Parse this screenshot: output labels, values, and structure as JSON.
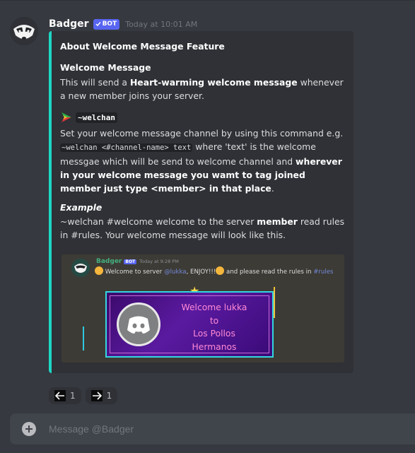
{
  "message": {
    "username": "Badger",
    "bot_tag": "BOT",
    "timestamp": "Today at 10:01 AM"
  },
  "embed": {
    "accent_color": "#1ed6c4",
    "title": "About Welcome Message Feature",
    "field1": {
      "name": "Welcome Message",
      "text_a": "This will send a ",
      "text_bold": "Heart-warming welcome message",
      "text_b": " whenever a new member joins your server."
    },
    "field2": {
      "command": "~welchan",
      "text_a": "Set your welcome message channel by using this command e.g. ",
      "code": "~welchan <#channel-name> text",
      "text_b": " where 'text' is the welcome messgae which will be send to welcome channel and ",
      "text_bold": "wherever in your welcome message you wamt to tag joined member just type <member> in that place",
      "text_c": "."
    },
    "field3": {
      "name": "Example",
      "text_a": "~welchan #welcome welcome to the server ",
      "text_bold": "member",
      "text_b": " read rules in #rules. Your welcome message will look like this."
    },
    "preview": {
      "username": "Badger",
      "bot_tag": "BOT",
      "timestamp": "Today at 9:28 PM",
      "text_a": "Welcome to server ",
      "mention": "@lukka",
      "text_b": ", ENJOY!!!",
      "text_c": " and please read the rules in ",
      "channel": "#rules",
      "card_line1": "Welcome lukka",
      "card_line2": "to",
      "card_line3": "Los Pollos",
      "card_line4": "Hermanos"
    }
  },
  "reactions": [
    {
      "icon": "arrow-left-icon",
      "count": "1"
    },
    {
      "icon": "arrow-right-icon",
      "count": "1"
    }
  ],
  "composer": {
    "placeholder": "Message @Badger"
  }
}
